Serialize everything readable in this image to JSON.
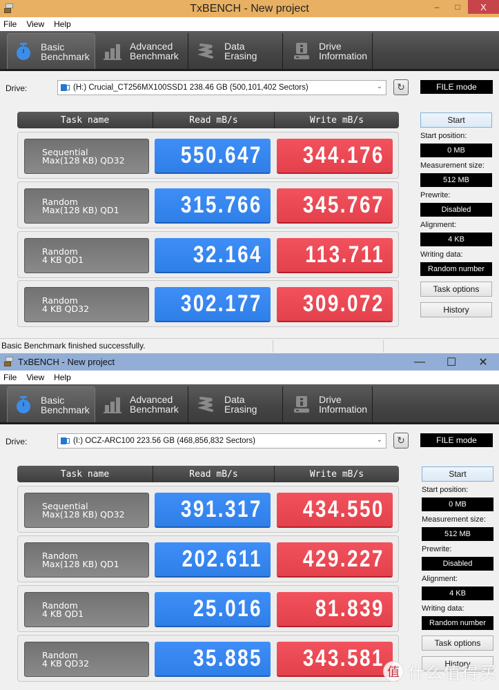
{
  "windows": [
    {
      "title": "TxBENCH - New project",
      "controls": {
        "minimize": "–",
        "maximize": "□",
        "close": "X"
      },
      "menu": [
        "File",
        "View",
        "Help"
      ],
      "toolbar": [
        {
          "line1": "Basic",
          "line2": "Benchmark",
          "icon": "stopwatch-icon",
          "active": true
        },
        {
          "line1": "Advanced",
          "line2": "Benchmark",
          "icon": "bar-chart-icon",
          "active": false
        },
        {
          "line1": "Data Erasing",
          "line2": "",
          "icon": "eraser-spring-icon",
          "active": false
        },
        {
          "line1": "Drive",
          "line2": "Information",
          "icon": "drive-info-icon",
          "active": false
        }
      ],
      "drive_label": "Drive:",
      "drive_value": "(H:) Crucial_CT256MX100SSD1  238.46 GB (500,101,402 Sectors)",
      "mode": "FILE mode",
      "headers": [
        "Task name",
        "Read mB/s",
        "Write mB/s"
      ],
      "rows": [
        {
          "task1": "Sequential",
          "task2": "Max(128 KB) QD32",
          "read": "550.647",
          "write": "344.176"
        },
        {
          "task1": "Random",
          "task2": "Max(128 KB) QD1",
          "read": "315.766",
          "write": "345.767"
        },
        {
          "task1": "Random",
          "task2": "4 KB QD1",
          "read": "32.164",
          "write": "113.711"
        },
        {
          "task1": "Random",
          "task2": "4 KB QD32",
          "read": "302.177",
          "write": "309.072"
        }
      ],
      "side": {
        "start": "Start",
        "start_position_label": "Start position:",
        "start_position": "0 MB",
        "measurement_size_label": "Measurement size:",
        "measurement_size": "512 MB",
        "prewrite_label": "Prewrite:",
        "prewrite": "Disabled",
        "alignment_label": "Alignment:",
        "alignment": "4 KB",
        "writing_data_label": "Writing data:",
        "writing_data": "Random number",
        "task_options": "Task options",
        "history": "History"
      },
      "status": "Basic Benchmark finished successfully."
    },
    {
      "title": "TxBENCH - New project",
      "controls": {
        "minimize": "—",
        "maximize": "☐",
        "close": "✕"
      },
      "menu": [
        "File",
        "View",
        "Help"
      ],
      "toolbar": [
        {
          "line1": "Basic",
          "line2": "Benchmark",
          "icon": "stopwatch-icon",
          "active": true
        },
        {
          "line1": "Advanced",
          "line2": "Benchmark",
          "icon": "bar-chart-icon",
          "active": false
        },
        {
          "line1": "Data Erasing",
          "line2": "",
          "icon": "eraser-spring-icon",
          "active": false
        },
        {
          "line1": "Drive",
          "line2": "Information",
          "icon": "drive-info-icon",
          "active": false
        }
      ],
      "drive_label": "Drive:",
      "drive_value": "(I:) OCZ-ARC100  223.56 GB (468,856,832 Sectors)",
      "mode": "FILE mode",
      "headers": [
        "Task name",
        "Read mB/s",
        "Write mB/s"
      ],
      "rows": [
        {
          "task1": "Sequential",
          "task2": "Max(128 KB) QD32",
          "read": "391.317",
          "write": "434.550"
        },
        {
          "task1": "Random",
          "task2": "Max(128 KB) QD1",
          "read": "202.611",
          "write": "429.227"
        },
        {
          "task1": "Random",
          "task2": "4 KB QD1",
          "read": "25.016",
          "write": "81.839"
        },
        {
          "task1": "Random",
          "task2": "4 KB QD32",
          "read": "35.885",
          "write": "343.581"
        }
      ],
      "side": {
        "start": "Start",
        "start_position_label": "Start position:",
        "start_position": "0 MB",
        "measurement_size_label": "Measurement size:",
        "measurement_size": "512 MB",
        "prewrite_label": "Prewrite:",
        "prewrite": "Disabled",
        "alignment_label": "Alignment:",
        "alignment": "4 KB",
        "writing_data_label": "Writing data:",
        "writing_data": "Random number",
        "task_options": "Task options",
        "history": "History"
      }
    }
  ],
  "watermark": {
    "badge": "值",
    "text": "什么值得买"
  },
  "colors": {
    "read": "#3a89f2",
    "write": "#ea4953",
    "title_active_1": "#e8b062",
    "title_active_2": "#92aed6"
  }
}
